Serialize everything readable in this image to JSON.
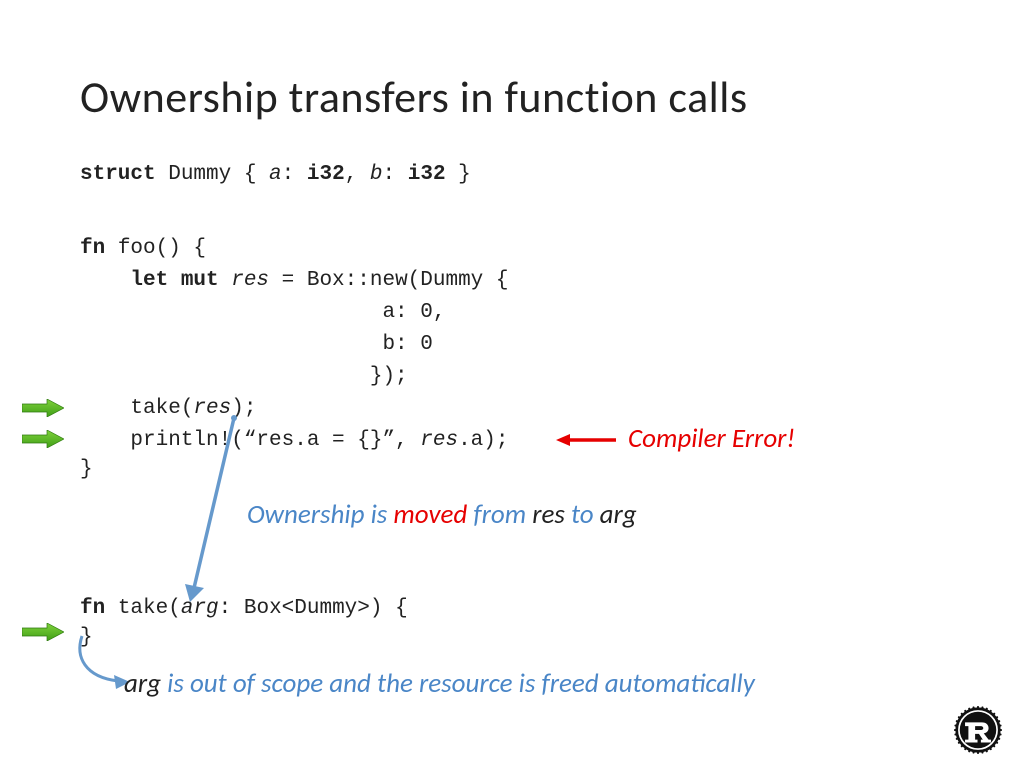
{
  "title": "Ownership transfers in function calls",
  "code": {
    "l1_struct": "struct",
    "l1_dummy": " Dummy { ",
    "l1_a": "a",
    "l1_i32a": ": ",
    "l1_i32a_kw": "i32",
    "l1_comma": ", ",
    "l1_b": "b",
    "l1_i32b": ": ",
    "l1_i32b_kw": "i32",
    "l1_end": " }",
    "l3_fn": "fn",
    "l3_foo": " foo() {",
    "l4_letmut": "    let mut",
    "l4_res": " res",
    "l4_eq": " = Box::new(Dummy {",
    "l5": "                        a: 0,",
    "l6": "                        b: 0",
    "l7": "                       });",
    "l8_take": "    take(",
    "l8_res": "res",
    "l8_end": ");",
    "l9_pre": "    println!(“res.a = {}”, ",
    "l9_res": "res",
    "l9_end": ".a);",
    "l10": "}",
    "l12_fn": "fn",
    "l12_take": " take(",
    "l12_arg": "arg",
    "l12_sig": ": Box<Dummy>) {",
    "l13": "}"
  },
  "annotations": {
    "compiler_error": "Compiler Error!",
    "ownership_prefix": "Ownership is ",
    "ownership_moved": "moved",
    "ownership_from": " from ",
    "ownership_res": "res",
    "ownership_to": " to ",
    "ownership_arg": "arg",
    "arg_prefix": "arg",
    "arg_rest": " is out of scope and the resource is freed automatically"
  }
}
